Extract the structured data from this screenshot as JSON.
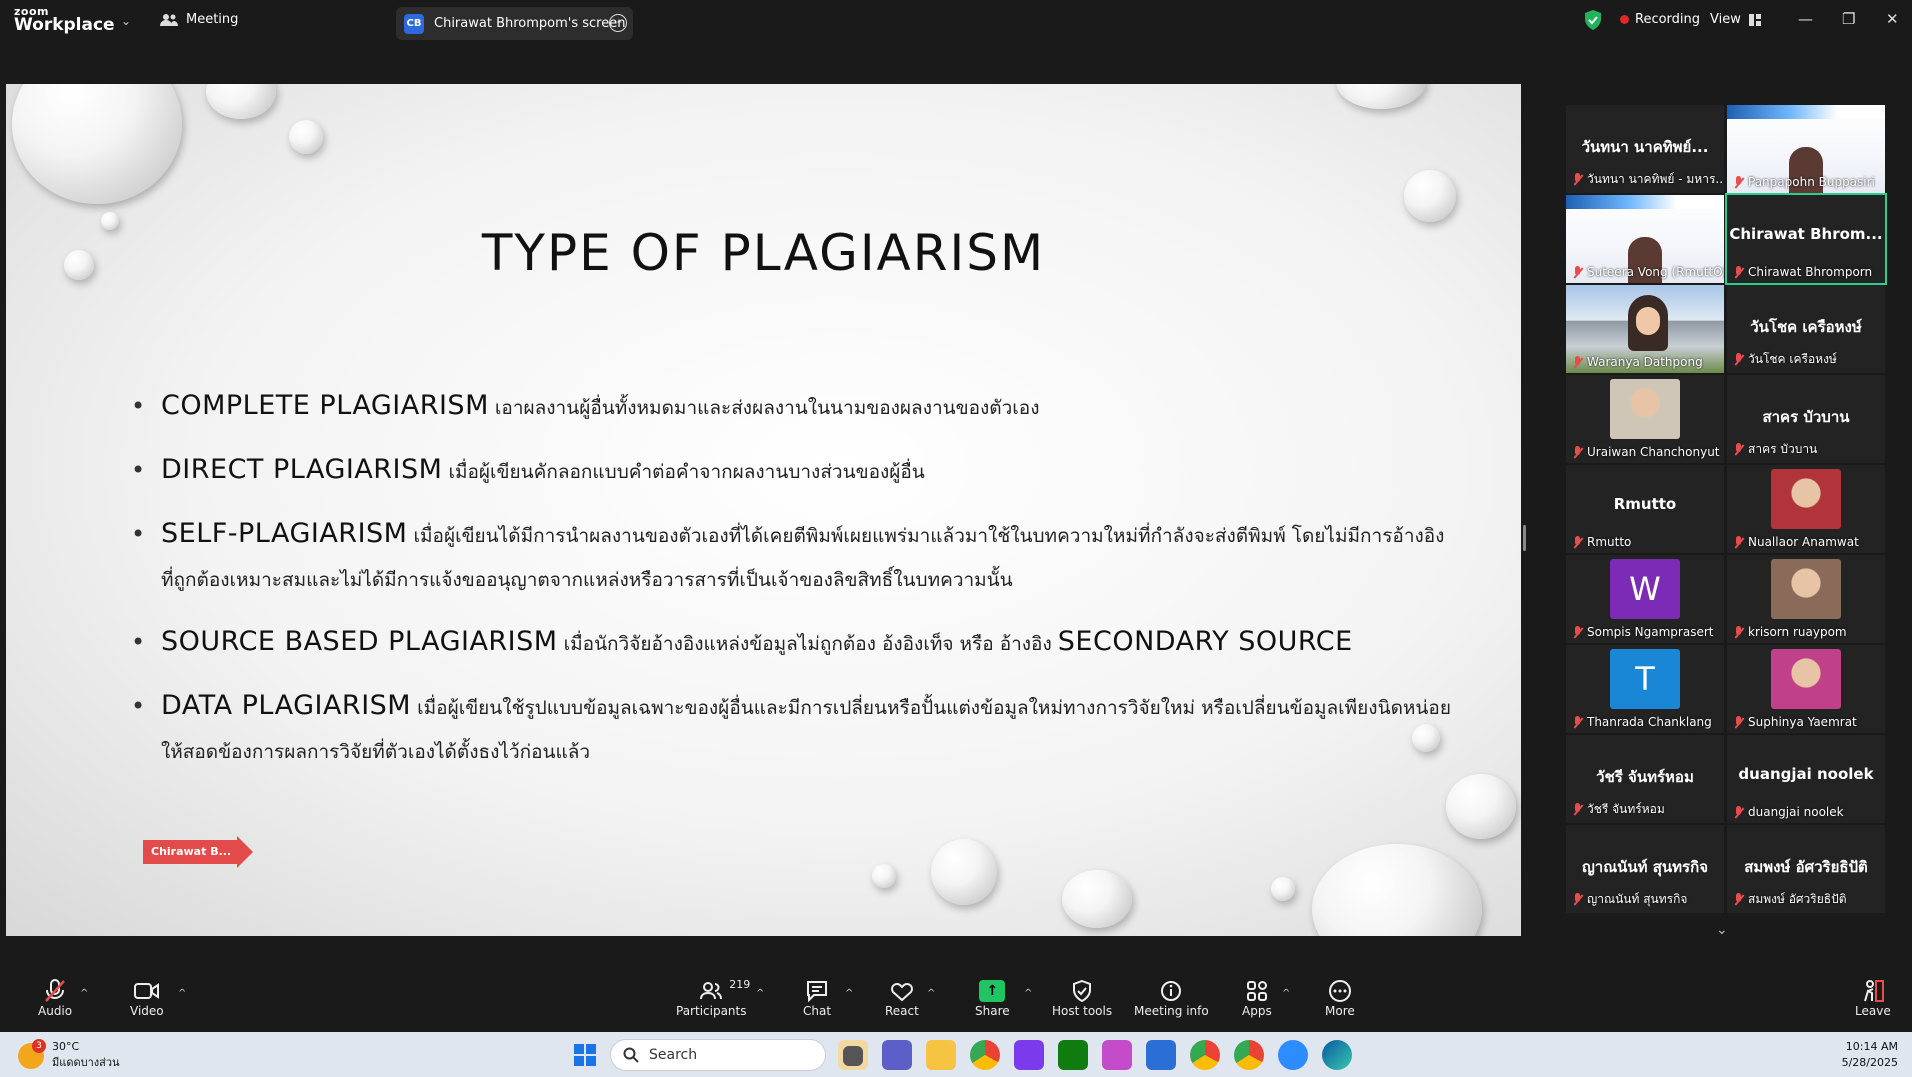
{
  "app": {
    "logo_top": "zoom",
    "logo_bottom": "Workplace",
    "meeting_label": "Meeting",
    "screen_tab_badge": "CB",
    "screen_tab_label": "Chirawat Bhrompom's screen",
    "recording_label": "Recording",
    "view_label": "View"
  },
  "slide": {
    "title": "TYPE OF PLAGIARISM",
    "bullets": [
      {
        "term": "COMPLETE PLAGIARISM",
        "text": " เอาผลงานผู้อื่นทั้งหมดมาและส่งผลงานในนามของผลงานของตัวเอง"
      },
      {
        "term": "DIRECT PLAGIARISM",
        "text": " เมื่อผู้เขียนคักลอกแบบคำต่อคำจากผลงานบางส่วนของผู้อื่น"
      },
      {
        "term": "SELF-PLAGIARISM",
        "text": " เมื่อผู้เขียนได้มีการนำผลงานของตัวเองที่ได้เคยตีพิมพ์เผยแพร่มาแล้วมาใช้ในบทความใหม่ที่กำลังจะส่งตีพิมพ์ โดยไม่มีการอ้างอิงที่ถูกต้องเหมาะสมและไม่ได้มีการแจ้งขออนุญาตจากแหล่งหรือวารสารที่เป็นเจ้าของลิขสิทธิ์ในบทความนั้น"
      },
      {
        "term": "SOURCE BASED PLAGIARISM",
        "text": " เมื่อนักวิจัยอ้างอิงแหล่งข้อมูลไม่ถูกต้อง อ้งอิงเท็จ หรือ อ้างอิง ",
        "term2": "SECONDARY SOURCE"
      },
      {
        "term": "DATA PLAGIARISM",
        "text": " เมื่อผู้เขียนใช้รูปแบบข้อมูลเฉพาะของผู้อื่นและมีการเปลี่ยนหรือปั้นแต่งข้อมูลใหม่ทางการวิจัยใหม่ หรือเปลี่ยนข้อมูลเพียงนิดหน่อยให้สอดข้องการผลการวิจัยที่ตัวเองได้ตั้งธงไว้ก่อนแล้ว"
      }
    ],
    "pointer_label": "Chirawat B..."
  },
  "participants": [
    {
      "big": "วันทนา นาคทิพย์...",
      "label": "วันทนา นาคทิพย์ - มหาร...",
      "kind": "name"
    },
    {
      "big": "",
      "label": "Panpapohn Buppasiri",
      "kind": "slide"
    },
    {
      "big": "",
      "label": "Suteera Vong (RmuttO)",
      "kind": "slide"
    },
    {
      "big": "Chirawat  Bhrom...",
      "label": "Chirawat Bhromporn",
      "kind": "name",
      "active": true
    },
    {
      "big": "",
      "label": "Waranya Dathpong",
      "kind": "building"
    },
    {
      "big": "วันโชค เครือหงษ์",
      "label": "วันโชค เครือหงษ์",
      "kind": "name"
    },
    {
      "big": "",
      "label": "Uraiwan Chanchonyut",
      "kind": "photo",
      "color": "#cfc6b8"
    },
    {
      "big": "สาคร บัวบาน",
      "label": "สาคร บัวบาน",
      "kind": "name"
    },
    {
      "big": "Rmutto",
      "label": "Rmutto",
      "kind": "name"
    },
    {
      "big": "",
      "label": "Nuallaor Anamwat",
      "kind": "photo",
      "color": "#b0343a"
    },
    {
      "big": "W",
      "label": "Sompis Ngamprasert",
      "kind": "letter",
      "color": "#7b2bb5"
    },
    {
      "big": "",
      "label": "krisorn ruaypom",
      "kind": "photo",
      "color": "#8a6a58"
    },
    {
      "big": "T",
      "label": "Thanrada Chanklang",
      "kind": "letter",
      "color": "#1a86d6"
    },
    {
      "big": "",
      "label": "Suphinya Yaemrat",
      "kind": "photo",
      "color": "#c0408a"
    },
    {
      "big": "วัชรี จันทร์หอม",
      "label": "วัชรี จันทร์หอม",
      "kind": "name"
    },
    {
      "big": "duangjai noolek",
      "label": "duangjai noolek",
      "kind": "name"
    },
    {
      "big": "ญาณนันท์ สุนทรกิจ",
      "label": "ญาณนันท์ สุนทรกิจ",
      "kind": "name"
    },
    {
      "big": "สมพงษ์ อัศวริยธิปัติ",
      "label": "สมพงษ์ อัศวริยธิปัติ",
      "kind": "name"
    }
  ],
  "toolbar": {
    "audio": "Audio",
    "video": "Video",
    "participants": "Participants",
    "participants_count": "219",
    "chat": "Chat",
    "react": "React",
    "share": "Share",
    "host_tools": "Host tools",
    "meeting_info": "Meeting info",
    "apps": "Apps",
    "more": "More",
    "leave": "Leave"
  },
  "taskbar": {
    "weather_temp": "30°C",
    "weather_desc": "มีแดดบางส่วน",
    "weather_badge": "3",
    "search_placeholder": "Search",
    "time": "10:14 AM",
    "date": "5/28/2025"
  },
  "colors": {
    "accent_green": "#2ecc8f",
    "record_red": "#e02828",
    "share_green": "#21c463",
    "pointer_red": "#e34b4b"
  }
}
